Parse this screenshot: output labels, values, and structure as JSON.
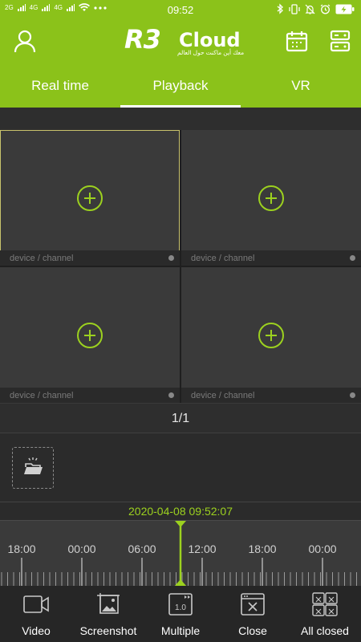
{
  "status_bar": {
    "time": "09:52",
    "left_indicators": [
      "2G",
      "4G",
      "4G"
    ],
    "battery_color": "#8bc21a"
  },
  "header": {
    "logo_r3": "R3",
    "logo_cloud": "Cloud",
    "logo_tagline": "معك أين ماكنت حول العالم",
    "icons": [
      "user-icon",
      "calendar-icon",
      "device-list-icon"
    ]
  },
  "tabs": [
    {
      "label": "Real time",
      "active": false
    },
    {
      "label": "Playback",
      "active": true
    },
    {
      "label": "VR",
      "active": false
    }
  ],
  "grid": {
    "cells": [
      {
        "label": "device / channel",
        "selected": true
      },
      {
        "label": "device / channel",
        "selected": false
      },
      {
        "label": "device / channel",
        "selected": false
      },
      {
        "label": "device / channel",
        "selected": false
      }
    ]
  },
  "pager": {
    "text": "1/1"
  },
  "playback": {
    "timestamp": "2020-04-08 09:52:07",
    "timeline_labels": [
      "18:00",
      "00:00",
      "06:00",
      "12:00",
      "18:00",
      "00:00"
    ]
  },
  "toolbar": {
    "items": [
      {
        "label": "Video",
        "icon": "video-camera-icon"
      },
      {
        "label": "Screenshot",
        "icon": "screenshot-icon"
      },
      {
        "label": "Multiple",
        "icon": "playback-speed-icon",
        "icon_text": "1.0"
      },
      {
        "label": "Close",
        "icon": "close-window-icon"
      },
      {
        "label": "All closed",
        "icon": "close-all-icon"
      }
    ]
  },
  "colors": {
    "accent": "#8bc21a",
    "highlight": "#9cd11f",
    "background": "#2b2b2b"
  }
}
